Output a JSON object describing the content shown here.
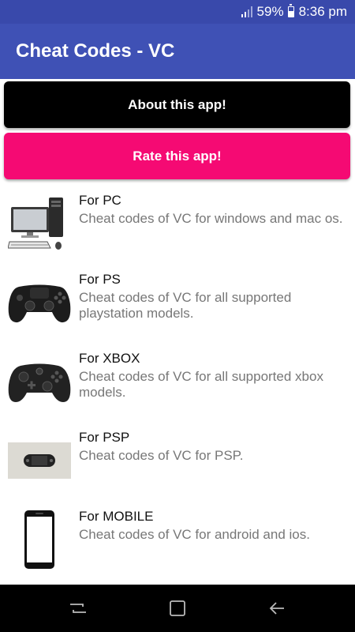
{
  "status": {
    "battery": "59%",
    "time": "8:36 pm",
    "battery_level": 0.59
  },
  "app": {
    "title": "Cheat Codes - VC"
  },
  "buttons": {
    "about": "About this app!",
    "rate": "Rate this app!"
  },
  "items": [
    {
      "title": "For PC",
      "desc": "Cheat codes of VC for windows and mac os.",
      "icon": "desktop-pc-icon"
    },
    {
      "title": "For PS",
      "desc": "Cheat codes of VC for all supported playstation models.",
      "icon": "ps-controller-icon"
    },
    {
      "title": "For XBOX",
      "desc": "Cheat codes of VC for all supported xbox models.",
      "icon": "xbox-controller-icon"
    },
    {
      "title": "For PSP",
      "desc": "Cheat codes of VC for PSP.",
      "icon": "psp-handheld-icon"
    },
    {
      "title": "For MOBILE",
      "desc": "Cheat codes of VC for android and ios.",
      "icon": "smartphone-icon"
    }
  ],
  "colors": {
    "statusbar": "#3949ab",
    "appbar": "#3f51b5",
    "about_button": "#000000",
    "rate_button": "#f50a73"
  }
}
